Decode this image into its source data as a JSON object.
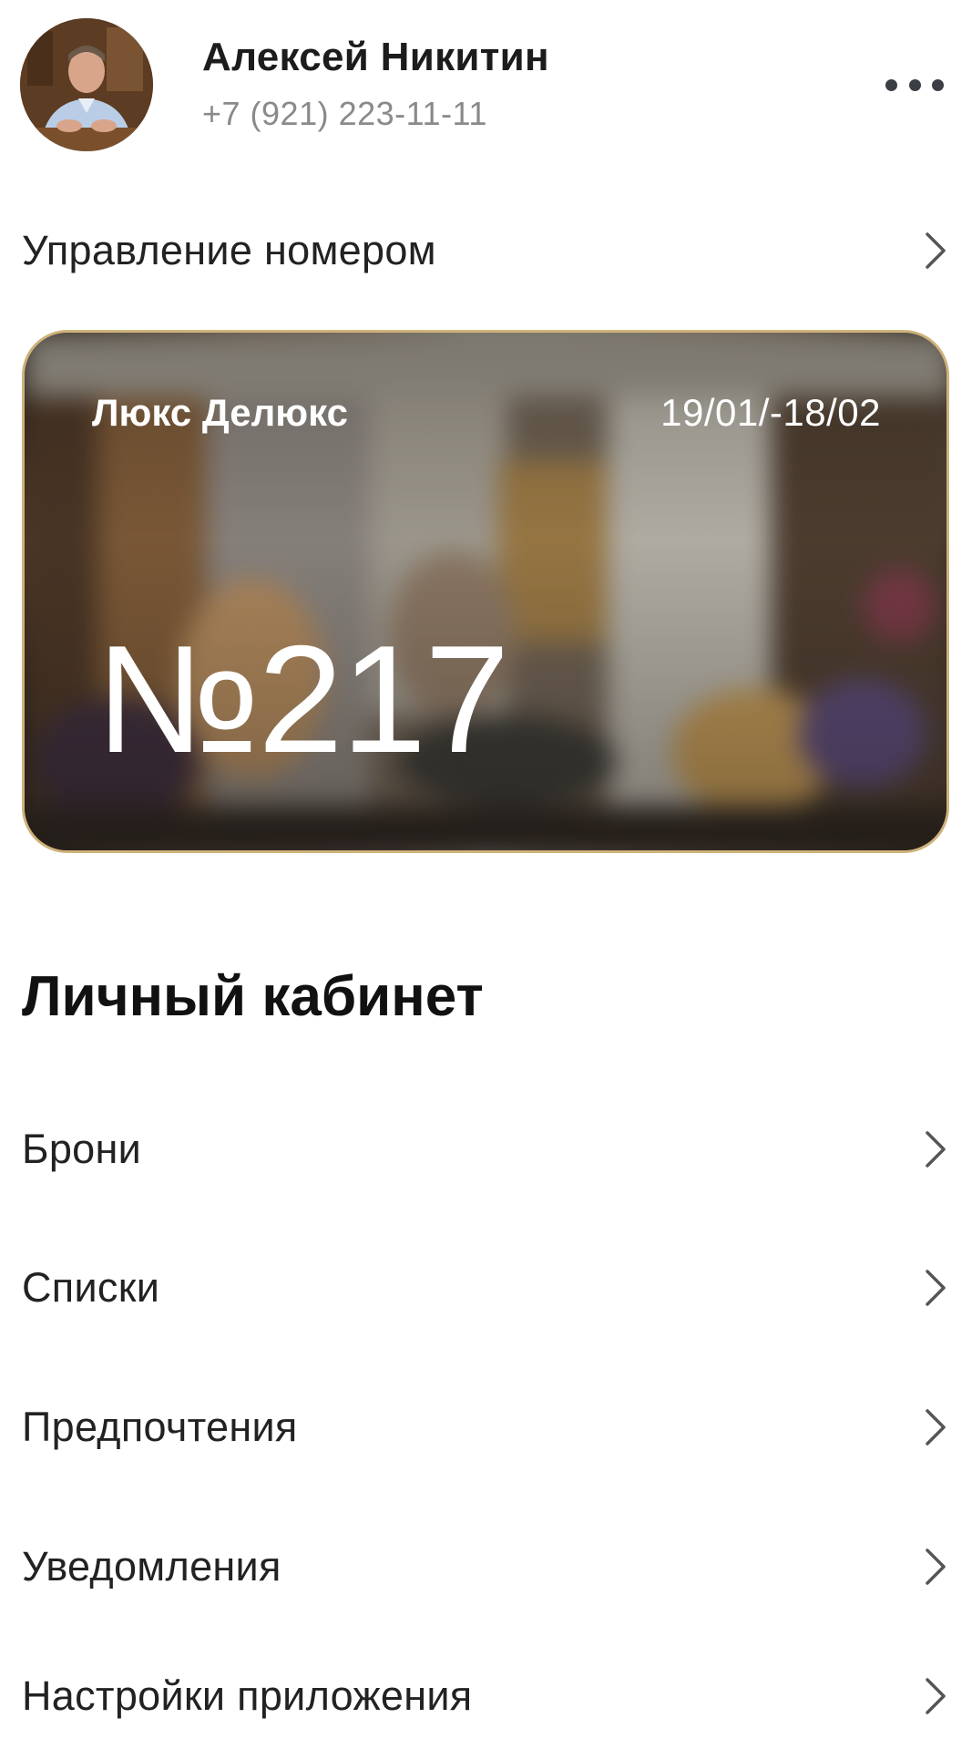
{
  "profile": {
    "name": "Алексей Никитин",
    "phone": "+7 (921) 223-11-11",
    "avatar_icon": "user-photo",
    "more_icon": "ellipsis-icon"
  },
  "manage_number": {
    "label": "Управление номером"
  },
  "room_card": {
    "type": "Люкс Делюкс",
    "dates": "19/01/-18/02",
    "number": "№217",
    "border_color": "#cfb27a"
  },
  "account": {
    "title": "Личный кабинет",
    "items": [
      {
        "label": "Брони"
      },
      {
        "label": "Списки"
      },
      {
        "label": "Предпочтения"
      },
      {
        "label": "Уведомления"
      },
      {
        "label": "Настройки приложения"
      }
    ]
  },
  "colors": {
    "text_primary": "#1c1c1c",
    "text_secondary": "#8a8a8a",
    "chevron": "#555555"
  }
}
